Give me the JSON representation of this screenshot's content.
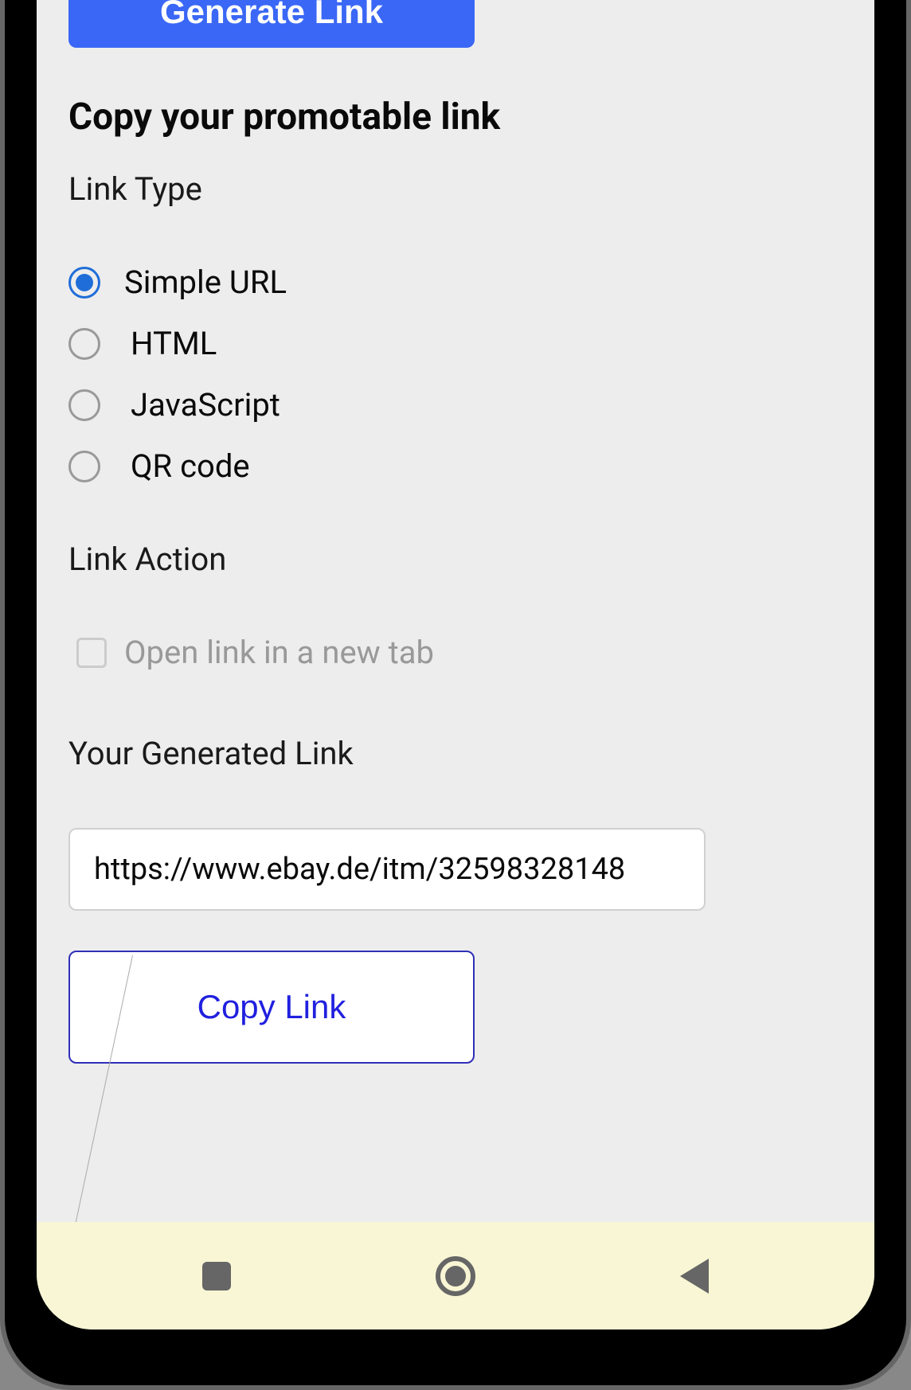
{
  "generateButton": "Generate Link",
  "sectionTitle": "Copy your promotable link",
  "linkTypeLabel": "Link Type",
  "radioOptions": [
    {
      "label": "Simple URL",
      "selected": true
    },
    {
      "label": "HTML",
      "selected": false
    },
    {
      "label": "JavaScript",
      "selected": false
    },
    {
      "label": "QR code",
      "selected": false
    }
  ],
  "linkActionLabel": "Link Action",
  "checkboxLabel": "Open link in a new tab",
  "generatedLinkLabel": "Your Generated Link",
  "generatedLinkValue": "https://www.ebay.de/itm/32598328148",
  "copyButton": "Copy Link"
}
